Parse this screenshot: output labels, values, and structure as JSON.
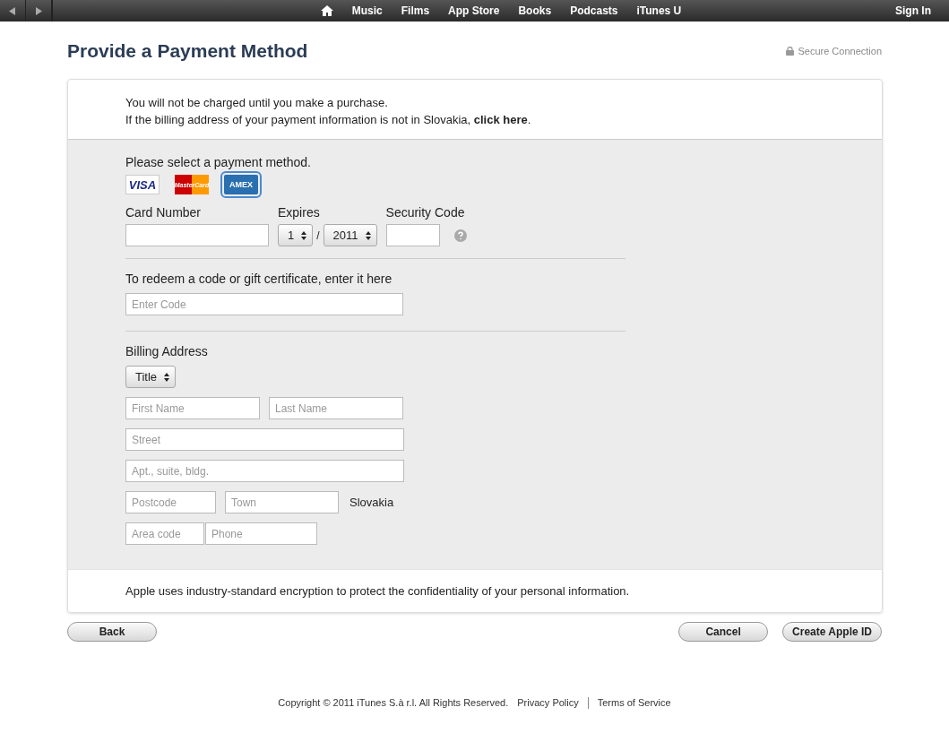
{
  "nav": {
    "items": [
      "Music",
      "Films",
      "App Store",
      "Books",
      "Podcasts",
      "iTunes U"
    ],
    "sign_in": "Sign In"
  },
  "title": "Provide a Payment Method",
  "secure": "Secure Connection",
  "notice": {
    "line1": "You will not be charged until you make a purchase.",
    "line2": "If the billing address of your payment information is not in Slovakia, **click here**."
  },
  "payment": {
    "prompt": "Please select a payment method.",
    "cards": [
      {
        "kind": "visa",
        "label": "VISA",
        "selected": false
      },
      {
        "kind": "mastercard",
        "label": "MasterCard",
        "selected": false
      },
      {
        "kind": "amex",
        "label": "AMEX",
        "selected": true
      }
    ],
    "card_number": {
      "label": "Card Number"
    },
    "expires": {
      "label": "Expires",
      "month": "1",
      "separator": "/",
      "year": "2011"
    },
    "security_code": {
      "label": "Security Code"
    }
  },
  "redeem": {
    "label": "To redeem a code or gift certificate, enter it here",
    "placeholder": "Enter Code"
  },
  "billing": {
    "label": "Billing Address",
    "title": "Title",
    "first_name": {
      "placeholder": "First Name"
    },
    "last_name": {
      "placeholder": "Last Name"
    },
    "street": {
      "placeholder": "Street"
    },
    "apt": {
      "placeholder": "Apt., suite, bldg."
    },
    "postcode": {
      "placeholder": "Postcode"
    },
    "town": {
      "placeholder": "Town"
    },
    "country": "Slovakia",
    "area_code": {
      "placeholder": "Area code"
    },
    "phone": {
      "placeholder": "Phone"
    }
  },
  "encryption_note": "Apple uses industry-standard encryption to protect the confidentiality of your personal information.",
  "buttons": {
    "back": "Back",
    "cancel": "Cancel",
    "create": "Create Apple ID"
  },
  "footer": {
    "copyright": "Copyright © 2011 iTunes S.à r.l. All Rights Reserved.",
    "links": [
      "Privacy Policy",
      "Terms of Service"
    ]
  }
}
